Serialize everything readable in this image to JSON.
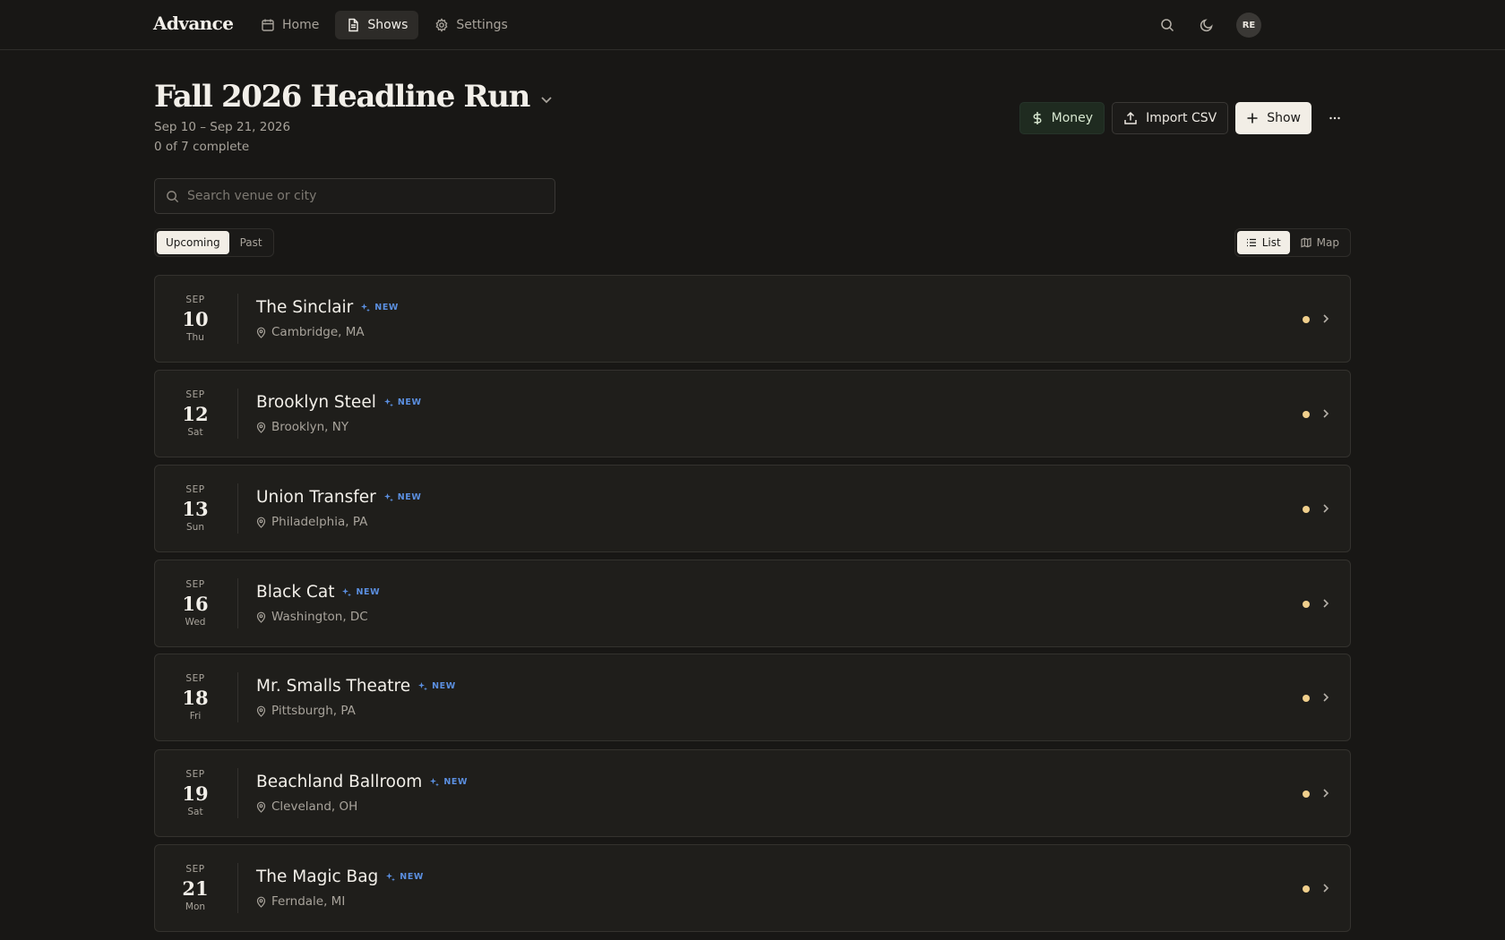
{
  "app": {
    "brand": "Advance"
  },
  "nav": [
    {
      "label": "Home",
      "icon": "calendar-icon",
      "active": false
    },
    {
      "label": "Shows",
      "icon": "document-icon",
      "active": true
    },
    {
      "label": "Settings",
      "icon": "gear-icon",
      "active": false
    }
  ],
  "user": {
    "initials": "RE"
  },
  "header": {
    "title": "Fall 2026 Headline Run",
    "date_range": "Sep 10 – Sep 21, 2026",
    "progress": "0 of 7 complete"
  },
  "actions": {
    "money_label": "Money",
    "import_label": "Import CSV",
    "add_show_label": "Show"
  },
  "search": {
    "placeholder": "Search venue or city",
    "value": ""
  },
  "filters": {
    "time": [
      {
        "label": "Upcoming",
        "active": true
      },
      {
        "label": "Past",
        "active": false
      }
    ],
    "view": [
      {
        "label": "List",
        "active": true,
        "icon": "list-icon"
      },
      {
        "label": "Map",
        "active": false,
        "icon": "map-icon"
      }
    ]
  },
  "badge_label": "NEW",
  "colors": {
    "accent_badge": "#5b8fe0",
    "status_pending": "#f0cf8c",
    "money_bg": "#1f2b20"
  },
  "shows": [
    {
      "month": "SEP",
      "day": "10",
      "weekday": "Thu",
      "venue": "The Sinclair",
      "city": "Cambridge, MA"
    },
    {
      "month": "SEP",
      "day": "12",
      "weekday": "Sat",
      "venue": "Brooklyn Steel",
      "city": "Brooklyn, NY"
    },
    {
      "month": "SEP",
      "day": "13",
      "weekday": "Sun",
      "venue": "Union Transfer",
      "city": "Philadelphia, PA"
    },
    {
      "month": "SEP",
      "day": "16",
      "weekday": "Wed",
      "venue": "Black Cat",
      "city": "Washington, DC"
    },
    {
      "month": "SEP",
      "day": "18",
      "weekday": "Fri",
      "venue": "Mr. Smalls Theatre",
      "city": "Pittsburgh, PA"
    },
    {
      "month": "SEP",
      "day": "19",
      "weekday": "Sat",
      "venue": "Beachland Ballroom",
      "city": "Cleveland, OH"
    },
    {
      "month": "SEP",
      "day": "21",
      "weekday": "Mon",
      "venue": "The Magic Bag",
      "city": "Ferndale, MI"
    }
  ]
}
